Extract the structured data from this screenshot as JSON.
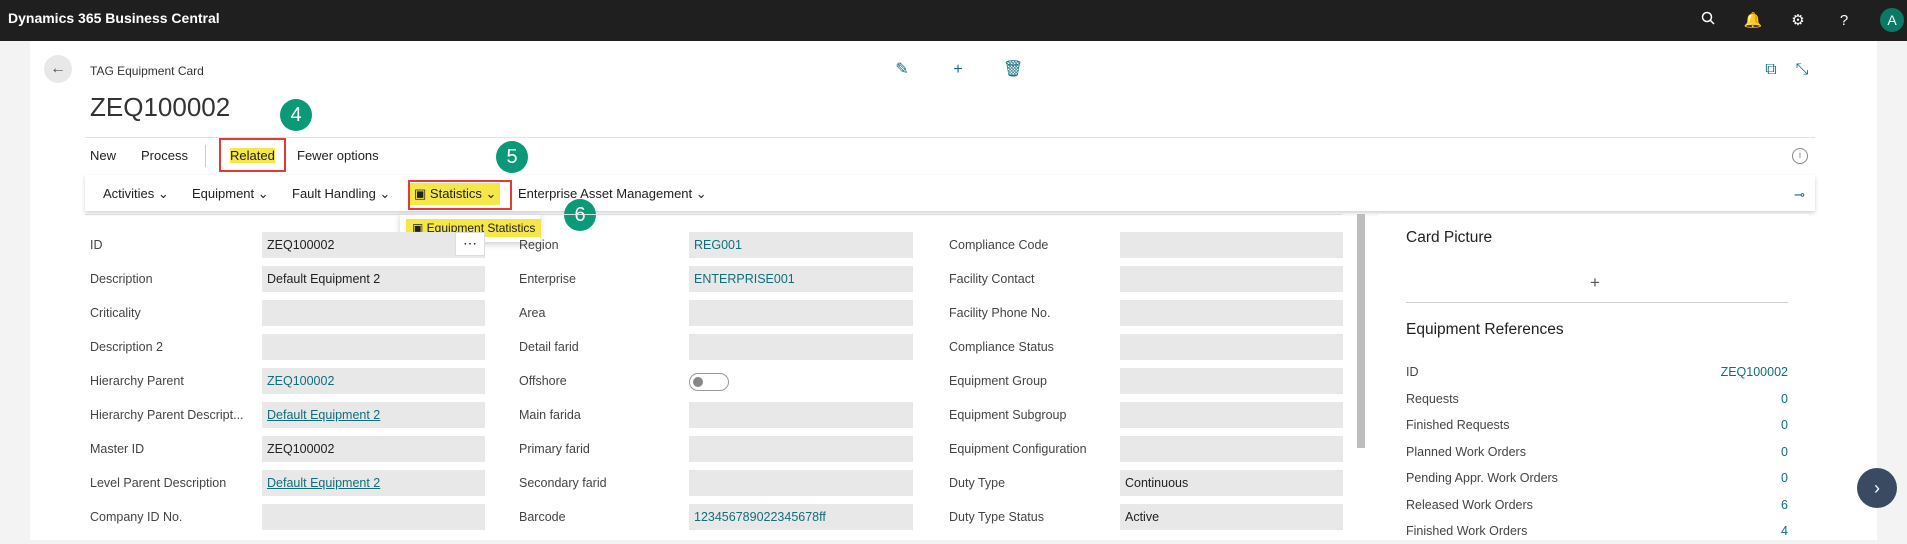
{
  "app_title": "Dynamics 365 Business Central",
  "avatar_letter": "A",
  "page_caption": "TAG Equipment Card",
  "record_title": "ZEQ100002",
  "actions": {
    "new": "New",
    "process": "Process",
    "related": "Related",
    "fewer": "Fewer options"
  },
  "submenu": {
    "activities": "Activities",
    "equipment": "Equipment",
    "fault_handling": "Fault Handling",
    "statistics": "Statistics",
    "eam": "Enterprise Asset Management"
  },
  "dropdown_item": "Equipment Statistics",
  "callouts": [
    "4",
    "5",
    "6"
  ],
  "col1": [
    {
      "label": "ID",
      "value": "ZEQ100002",
      "link": false
    },
    {
      "label": "Description",
      "value": "Default Equipment 2",
      "link": false
    },
    {
      "label": "Criticality",
      "value": "",
      "link": false
    },
    {
      "label": "Description 2",
      "value": "",
      "link": false
    },
    {
      "label": "Hierarchy Parent",
      "value": "ZEQ100002",
      "link": true
    },
    {
      "label": "Hierarchy Parent Descript...",
      "value": "Default Equipment 2",
      "link": true
    },
    {
      "label": "Master ID",
      "value": "ZEQ100002",
      "link": false
    },
    {
      "label": "Level Parent Description",
      "value": "Default Equipment 2",
      "link": true
    },
    {
      "label": "Company ID No.",
      "value": "",
      "link": false
    }
  ],
  "col2": [
    {
      "label": "Region",
      "value": "REG001",
      "link": true
    },
    {
      "label": "Enterprise",
      "value": "ENTERPRISE001",
      "link": true
    },
    {
      "label": "Area",
      "value": "",
      "link": false
    },
    {
      "label": "Detail farid",
      "value": "",
      "link": false
    },
    {
      "label": "Offshore",
      "value": "",
      "link": false
    },
    {
      "label": "Main farida",
      "value": "",
      "link": false
    },
    {
      "label": "Primary farid",
      "value": "",
      "link": false
    },
    {
      "label": "Secondary farid",
      "value": "",
      "link": false
    },
    {
      "label": "Barcode",
      "value": "123456789022345678ff",
      "link": true
    }
  ],
  "col3": [
    {
      "label": "Compliance Code",
      "value": ""
    },
    {
      "label": "Facility Contact",
      "value": ""
    },
    {
      "label": "Facility Phone No.",
      "value": ""
    },
    {
      "label": "Compliance Status",
      "value": ""
    },
    {
      "label": "Equipment Group",
      "value": ""
    },
    {
      "label": "Equipment Subgroup",
      "value": ""
    },
    {
      "label": "Equipment Configuration",
      "value": ""
    },
    {
      "label": "Duty Type",
      "value": "Continuous"
    },
    {
      "label": "Duty Type Status",
      "value": "Active"
    }
  ],
  "factbox": {
    "card_picture": "Card Picture",
    "add_picture": "+",
    "refs_title": "Equipment References",
    "rows": [
      {
        "k": "ID",
        "v": "ZEQ100002"
      },
      {
        "k": "Requests",
        "v": "0"
      },
      {
        "k": "Finished Requests",
        "v": "0"
      },
      {
        "k": "Planned Work Orders",
        "v": "0"
      },
      {
        "k": "Pending Appr. Work Orders",
        "v": "0"
      },
      {
        "k": "Released Work Orders",
        "v": "6"
      },
      {
        "k": "Finished Work Orders",
        "v": "4"
      }
    ]
  }
}
